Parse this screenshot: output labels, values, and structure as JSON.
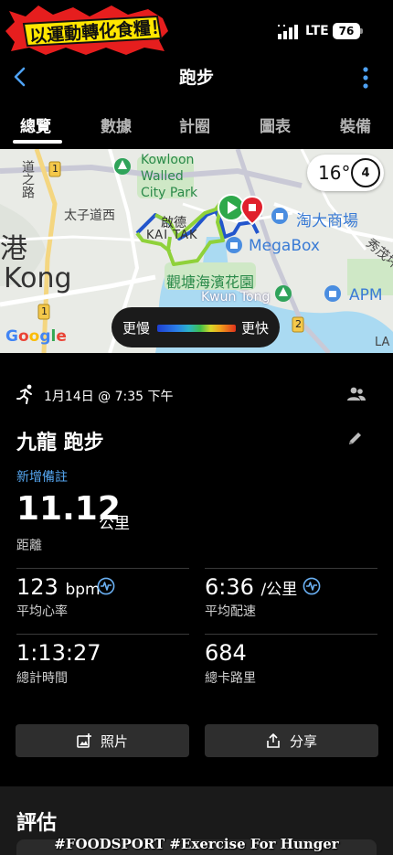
{
  "status_bar": {
    "sticker_text": "以運動轉化食糧！",
    "network": "LTE",
    "battery": "76"
  },
  "header": {
    "title": "跑步",
    "back_icon": "chevron-left-icon",
    "more_icon": "more-vertical-icon"
  },
  "tabs": [
    {
      "label": "總覽",
      "active": true
    },
    {
      "label": "數據",
      "active": false
    },
    {
      "label": "計圈",
      "active": false
    },
    {
      "label": "圖表",
      "active": false
    },
    {
      "label": "裝備",
      "active": false
    }
  ],
  "map": {
    "labels": {
      "kowloon_walled": "Kowloon",
      "walled": "Walled",
      "city_park": "City Park",
      "tai_tsz": "太子道西",
      "kai_tak_cn": "啟德",
      "kai_tak": "KAI TAK",
      "taoda": "淘大商場",
      "megabox": "MegaBox",
      "kwun_tong_park": "觀塘海濱花園",
      "kwun_tong": "Kwun Tong",
      "apm": "APM",
      "gang": "港",
      "kong": "Kong",
      "xiu_mao": "秀茂坪",
      "road_cn": "道之路",
      "la": "LA",
      "route_1a": "1",
      "route_1b": "1",
      "route_2": "2"
    },
    "weather": {
      "temperature": "16°",
      "wind": "4"
    },
    "legend": {
      "slow": "更慢",
      "fast": "更快"
    },
    "attribution": "Google",
    "colors": {
      "route_green": "#8fd13a",
      "route_blue": "#2255cc",
      "start": "#2ea84a",
      "end": "#e0202c"
    }
  },
  "activity": {
    "date": "1月14日 @ 7:35 下午",
    "title": "九龍 跑步",
    "add_note": "新增備註",
    "distance": {
      "value": "11.12",
      "unit": "公里",
      "label": "距離"
    },
    "stats": {
      "heart_rate": {
        "value": "123",
        "unit": "bpm",
        "label": "平均心率"
      },
      "pace": {
        "value": "6:36",
        "unit": "/公里",
        "label": "平均配速"
      },
      "time": {
        "value": "1:13:27",
        "label": "總計時間"
      },
      "calories": {
        "value": "684",
        "label": "總卡路里"
      }
    },
    "buttons": {
      "photo": "照片",
      "share": "分享"
    },
    "assessment_title": "評估"
  },
  "watermark": "#FOODSPORT #Exercise For Hunger"
}
